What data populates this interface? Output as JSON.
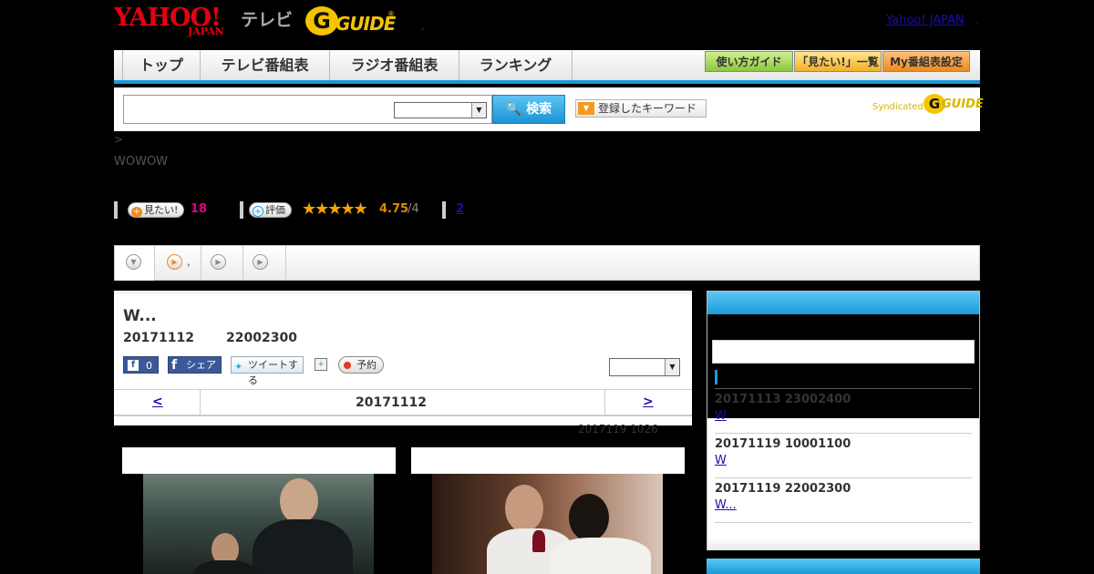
{
  "header": {
    "yahoo": "YAHOO!",
    "japan": "JAPAN",
    "tv": "テレビ",
    "g": "G",
    "guide": "GUIDE",
    "reg": "®",
    "dot": ",",
    "yahoo_japan_link": "Yahoo! JAPAN",
    "yahoo_japan_dot": "."
  },
  "nav": {
    "tabs": [
      "トップ",
      "テレビ番組表",
      "ラジオ番組表",
      "ランキング"
    ],
    "utility": [
      "使い方ガイド",
      "「見たい!」一覧",
      "My番組表設定"
    ]
  },
  "search": {
    "input_value": "",
    "select_value": "",
    "button_label": "検索",
    "keyword_label": "登録したキーワード",
    "syndicated": "Syndicated",
    "synd_g": "G",
    "synd_guide": "GUIDE"
  },
  "info": {
    "breadcrumb": ">",
    "channel": "WOWOW",
    "want_label": "見たい!",
    "want_count": "18",
    "rating_label": "評価",
    "stars": "★★★★★",
    "rating": "4.75",
    "rating_max": "/4",
    "review_count": "2"
  },
  "tabs": {
    "dot": ","
  },
  "program": {
    "title": "W...",
    "date": "20171112",
    "time": "22002300",
    "like_count": "0",
    "share_label": "シェア",
    "tweet_label": "ツイートする",
    "reserve_label": "予約",
    "select_value": "",
    "pager_prev": "<",
    "pager_date": "20171112",
    "pager_next": ">",
    "updated": "2017119  1026"
  },
  "side": {
    "items": [
      {
        "datetime": "20171113  23002400",
        "title": "W"
      },
      {
        "datetime": "20171119  10001100",
        "title": "W"
      },
      {
        "datetime": "20171119  22002300",
        "title": "W...  "
      }
    ]
  },
  "colors": {
    "accent_blue": "#199ad6",
    "yahoo_red": "#e60012",
    "guide_yellow": "#f5c400"
  }
}
